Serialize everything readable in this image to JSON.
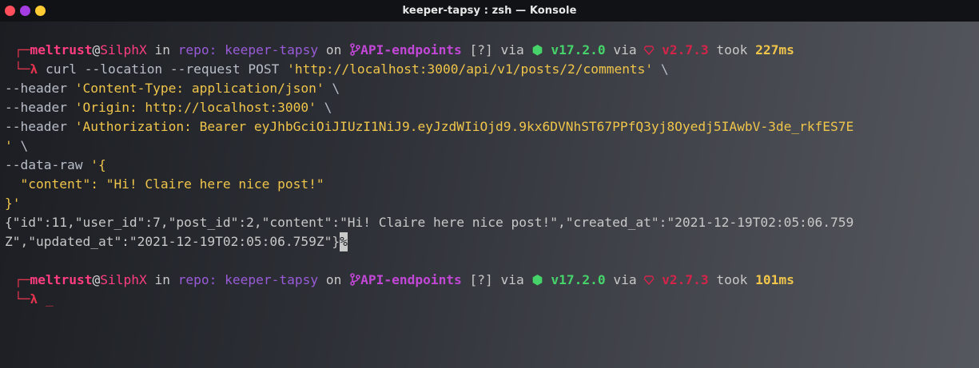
{
  "window": {
    "title": "keeper-tapsy : zsh — Konsole",
    "buttons": {
      "close_color": "#ff4e5b",
      "minimize_color": "#a53de3",
      "maximize_color": "#ffcc33"
    }
  },
  "prompt1": {
    "corner_top": "┌─",
    "user": "meltrust",
    "at": "@",
    "host": "SilphX",
    "in": " in ",
    "repo_label": "repo: keeper-tapsy",
    "on": " on ",
    "branch_icon": "",
    "branch": "API-endpoints",
    "status": " [?]",
    "via1": " via ",
    "node_icon": "⬢",
    "node_version": " v17.2.0",
    "via2": " via ",
    "ruby_icon": "💎",
    "ruby_version": " v2.7.3",
    "took": " took ",
    "duration": "227ms",
    "corner_bottom": "└─",
    "lambda": "λ"
  },
  "command": {
    "line1_cmd": " curl --location --request POST ",
    "line1_url": "'http://localhost:3000/api/v1/posts/2/comments'",
    "line1_tail": " \\",
    "line2_flag": "--header ",
    "line2_str": "'Content-Type: application/json'",
    "line2_tail": " \\",
    "line3_flag": "--header ",
    "line3_str": "'Origin: http://localhost:3000'",
    "line3_tail": " \\",
    "line4_flag": "--header ",
    "line4_str": "'Authorization: Bearer eyJhbGciOiJIUzI1NiJ9.eyJzdWIiOjd9.9kx6DVNhST67PPfQ3yj8Oyedj5IAwbV-3de_rkfES7E",
    "line5_str": "'",
    "line5_tail": " \\",
    "line6_flag": "--data-raw ",
    "line6_str": "'{",
    "line7_str": "  \"content\": \"Hi! Claire here nice post!\"",
    "line8_str": "}'"
  },
  "output": {
    "line1": "{\"id\":11,\"user_id\":7,\"post_id\":2,\"content\":\"Hi! Claire here nice post!\",\"created_at\":\"2021-12-19T02:05:06.759",
    "line2": "Z\",\"updated_at\":\"2021-12-19T02:05:06.759Z\"}",
    "eol_marker": "%"
  },
  "prompt2": {
    "corner_top": "┌─",
    "user": "meltrust",
    "at": "@",
    "host": "SilphX",
    "in": " in ",
    "repo_label": "repo: keeper-tapsy",
    "on": " on ",
    "branch_icon": "",
    "branch": "API-endpoints",
    "status": " [?]",
    "via1": " via ",
    "node_icon": "⬢",
    "node_version": " v17.2.0",
    "via2": " via ",
    "ruby_icon": "💎",
    "ruby_version": " v2.7.3",
    "took": " took ",
    "duration": "101ms",
    "corner_bottom": "└─",
    "lambda": "λ",
    "cursor": " _"
  }
}
